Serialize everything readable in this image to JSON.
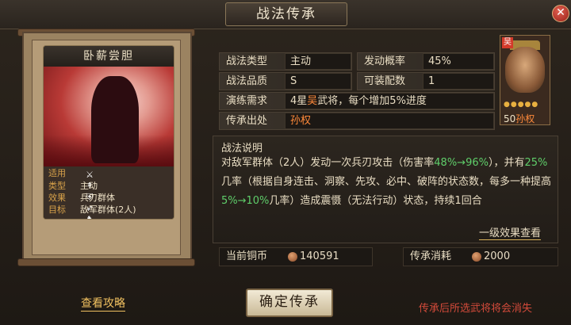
{
  "window": {
    "title": "战法传承",
    "close_label": "✕"
  },
  "skill_card": {
    "name": "卧薪尝胆",
    "info": [
      {
        "key": "适用",
        "value": ""
      },
      {
        "key": "类型",
        "value": "主动"
      },
      {
        "key": "效果",
        "value": "兵刃群体"
      },
      {
        "key": "目标",
        "value": "敌军群体(2人)"
      }
    ],
    "unit_icons": [
      "sword-icon",
      "spear-icon",
      "shield-icon",
      "bow-icon",
      "cavalry-icon",
      "wheel-icon"
    ]
  },
  "attributes": {
    "type": {
      "label": "战法类型",
      "value": "主动"
    },
    "chance": {
      "label": "发动概率",
      "value": "45%"
    },
    "quality": {
      "label": "战法品质",
      "value": "S"
    },
    "slots": {
      "label": "可装配数",
      "value": "1"
    },
    "training": {
      "label": "演练需求",
      "prefix": "4星",
      "faction": "吴",
      "suffix": "武将，每个增加5%进度"
    },
    "origin": {
      "label": "传承出处",
      "value": "孙权"
    }
  },
  "general": {
    "faction_seal": "吴",
    "level": "50",
    "name": "孙权",
    "stars": "●●●●●"
  },
  "description": {
    "title": "战法说明",
    "part1": "对敌军群体（2人）发动一次兵刃攻击（伤害率",
    "dmg_range": "48%→96%",
    "part2": "），并有",
    "chance": "25%",
    "part3": "几率（根据自身连击、洞察、先攻、必中、破阵的状态数，每多一种提高",
    "chance_range": "5%→10%",
    "part4": "几率）造成震慑（无法行动）状态，持续1回合"
  },
  "effect_link": "一级效果查看",
  "resources": {
    "copper": {
      "label": "当前铜币",
      "value": "140591"
    },
    "cost": {
      "label": "传承消耗",
      "value": "2000"
    }
  },
  "footer": {
    "guide_link": "查看攻略",
    "confirm_button": "确定传承",
    "warning": "传承后所选武将将会消失"
  }
}
